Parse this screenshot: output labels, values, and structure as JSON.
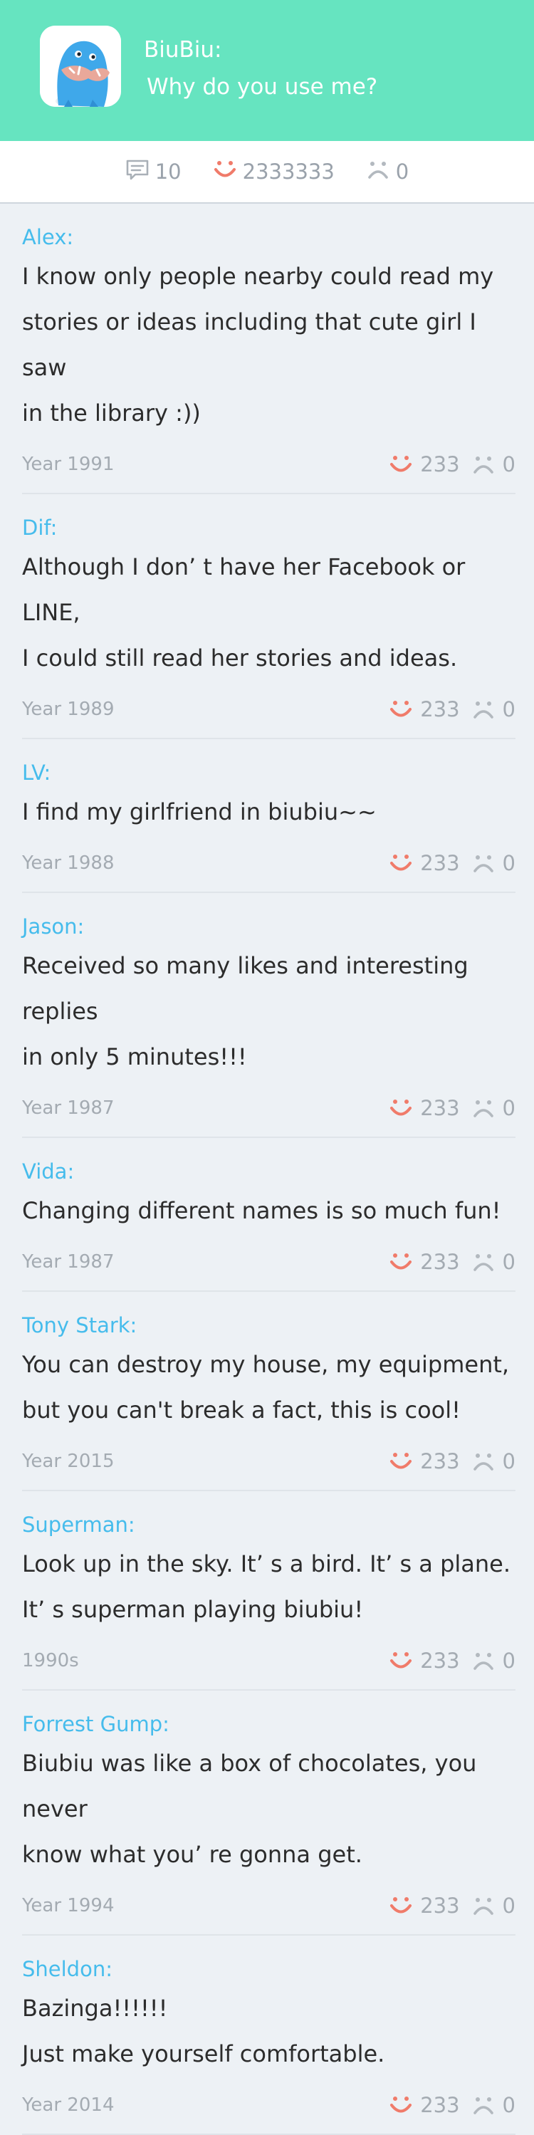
{
  "header": {
    "title": "BiuBiu:",
    "subtitle": "Why do you use me?",
    "app_icon": "biubiu-mascot-icon",
    "background_color": "#66e4c0"
  },
  "stats": {
    "comments": "10",
    "likes": "2333333",
    "dislikes": "0"
  },
  "colors": {
    "accent": "#46bcec",
    "like": "#f07b6a",
    "muted": "#a4abb2"
  },
  "stories": [
    {
      "author": "Alex:",
      "text": "I know only people nearby could read my\nstories or ideas including that cute girl I saw\nin the library :))",
      "date": "Year 1991",
      "likes": "233",
      "dislikes": "0"
    },
    {
      "author": "Dif:",
      "text": "Although I don’ t have her Facebook or LINE,\nI could still read her stories and ideas.",
      "date": "Year 1989",
      "likes": "233",
      "dislikes": "0"
    },
    {
      "author": "LV:",
      "text": "I find my girlfriend in biubiu~~",
      "date": "Year 1988",
      "likes": "233",
      "dislikes": "0"
    },
    {
      "author": "Jason:",
      "text": "Received so many likes and interesting replies\nin only 5 minutes!!!",
      "date": "Year 1987",
      "likes": "233",
      "dislikes": "0"
    },
    {
      "author": "Vida:",
      "text": "Changing different names is so much fun!",
      "date": "Year 1987",
      "likes": "233",
      "dislikes": "0"
    },
    {
      "author": "Tony Stark:",
      "text": "You can destroy my house, my equipment,\nbut you can't break a fact, this is cool!",
      "date": "Year 2015",
      "likes": "233",
      "dislikes": "0"
    },
    {
      "author": "Superman:",
      "text": "Look up in the sky. It’ s a bird. It’ s a plane.\nIt’ s superman playing biubiu!",
      "date": "1990s",
      "likes": "233",
      "dislikes": "0"
    },
    {
      "author": "Forrest Gump:",
      "text": "Biubiu was like a box of chocolates, you never\nknow what you’ re gonna get.",
      "date": "Year 1994",
      "likes": "233",
      "dislikes": "0"
    },
    {
      "author": "Sheldon:",
      "text": "Bazinga!!!!!!\nJust make yourself comfortable.",
      "date": "Year 2014",
      "likes": "233",
      "dislikes": "0"
    }
  ]
}
